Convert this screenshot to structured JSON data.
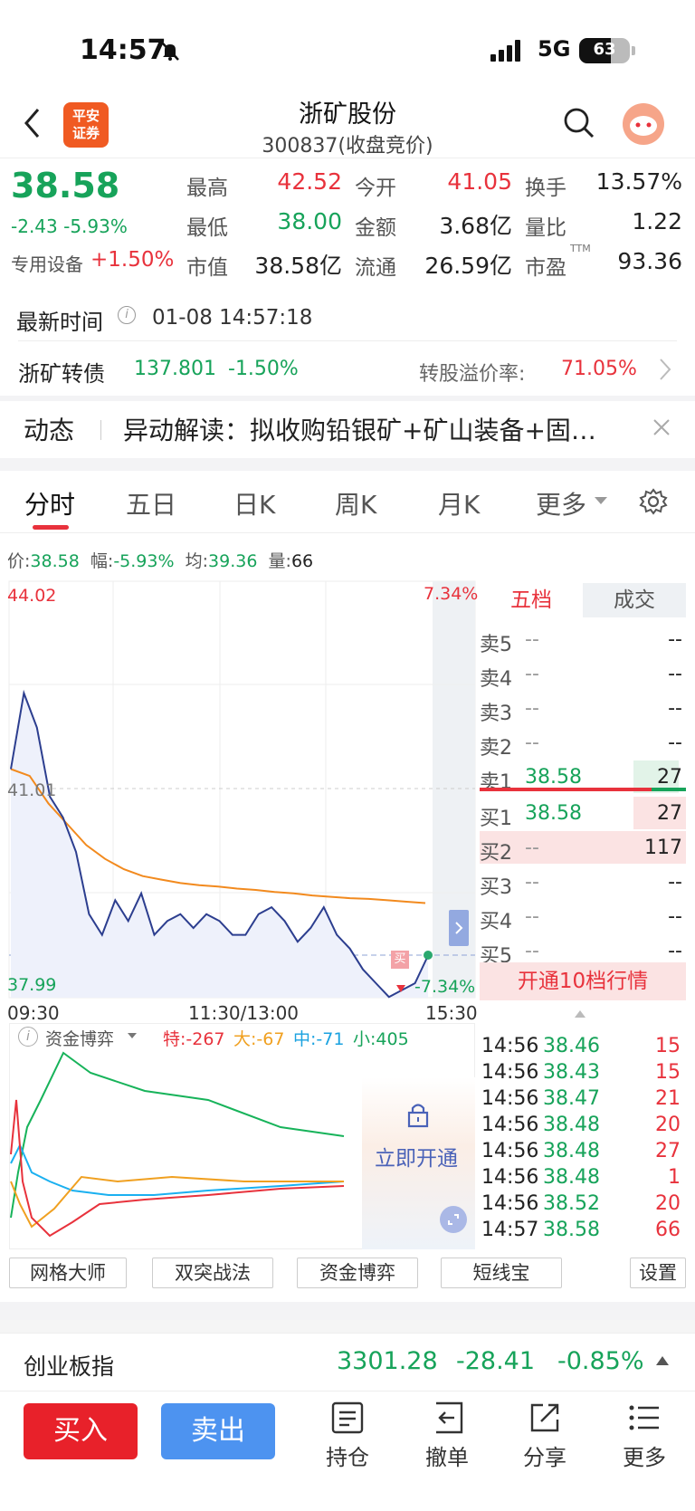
{
  "status_bar": {
    "time": "14:57",
    "network": "5G",
    "battery": "63",
    "battery_level": 0.63
  },
  "header": {
    "logo_line1": "平安",
    "logo_line2": "证券",
    "stock_name": "浙矿股份",
    "stock_code": "300837(收盘竞价)"
  },
  "quote": {
    "price": "38.58",
    "change": "-2.43",
    "change_pct": "-5.93%",
    "sector": "专用设备",
    "sector_change": "+1.50%",
    "high_label": "最高",
    "high": "42.52",
    "open_label": "今开",
    "open": "41.05",
    "turnover_label": "换手",
    "turnover": "13.57%",
    "low_label": "最低",
    "low": "38.00",
    "amount_label": "金额",
    "amount": "3.68亿",
    "vol_ratio_label": "量比",
    "vol_ratio": "1.22",
    "mcap_label": "市值",
    "mcap": "38.58亿",
    "float_label": "流通",
    "float": "26.59亿",
    "pe_label": "市盈",
    "pe_sup": "TTM",
    "pe": "93.36"
  },
  "update": {
    "label": "最新时间",
    "info_icon": "i",
    "time": "01-08 14:57:18"
  },
  "bond": {
    "name": "浙矿转债",
    "price": "137.801",
    "change": "-1.50%",
    "premium_label": "转股溢价率:",
    "premium": "71.05%"
  },
  "news": {
    "tag": "动态",
    "text": "异动解读：拟收购铅银矿+矿山装备+固…"
  },
  "tabs": [
    "分时",
    "五日",
    "日K",
    "周K",
    "月K",
    "更多"
  ],
  "info_line": {
    "p_label": "价:",
    "p": "38.58",
    "f_label": "幅:",
    "f": "-5.93%",
    "a_label": "均:",
    "a": "39.36",
    "v_label": "量:",
    "v": "66"
  },
  "intraday": {
    "y_top": "44.02",
    "y_mid": "41.01",
    "y_bottom": "37.99",
    "pct_top": "7.34%",
    "pct_bottom": "-7.34%",
    "x_start": "09:30",
    "x_mid": "11:30/13:00",
    "x_end": "15:30",
    "buy_marker": "买"
  },
  "chart_data": {
    "type": "line",
    "x": [
      "09:30",
      "11:30/13:00",
      "15:30"
    ],
    "ylim": [
      37.99,
      44.02
    ],
    "yref": 41.01,
    "series": [
      {
        "values": [
          41.3,
          42.4,
          41.9,
          40.9,
          40.6,
          40.1,
          39.2,
          38.9,
          39.4,
          39.1,
          39.5,
          38.9,
          39.1,
          39.2,
          39.0,
          39.2,
          39.1,
          38.9,
          38.9,
          39.2,
          39.3,
          39.1,
          38.8,
          39.0,
          39.3,
          38.9,
          38.7,
          38.4,
          38.2,
          38.0,
          38.1,
          38.2,
          38.6
        ]
      },
      {
        "values": [
          41.3,
          41.2,
          40.8,
          40.5,
          40.2,
          40.0,
          39.85,
          39.75,
          39.7,
          39.65,
          39.62,
          39.6,
          39.57,
          39.55,
          39.52,
          39.5,
          39.47,
          39.45,
          39.43,
          39.42,
          39.4,
          39.38,
          39.36
        ]
      }
    ]
  },
  "depth": {
    "tab_five": "五档",
    "tab_deals": "成交",
    "asks": [
      {
        "label": "卖5",
        "price": "--",
        "vol": "--"
      },
      {
        "label": "卖4",
        "price": "--",
        "vol": "--"
      },
      {
        "label": "卖3",
        "price": "--",
        "vol": "--"
      },
      {
        "label": "卖2",
        "price": "--",
        "vol": "--"
      },
      {
        "label": "卖1",
        "price": "38.58",
        "vol": "27"
      }
    ],
    "bids": [
      {
        "label": "买1",
        "price": "38.58",
        "vol": "27"
      },
      {
        "label": "买2",
        "price": "--",
        "vol": "117"
      },
      {
        "label": "买3",
        "price": "--",
        "vol": "--"
      },
      {
        "label": "买4",
        "price": "--",
        "vol": "--"
      },
      {
        "label": "买5",
        "price": "--",
        "vol": "--"
      }
    ],
    "open_ten": "开通10档行情"
  },
  "ticks": [
    {
      "time": "14:56",
      "price": "38.46",
      "vol": "15"
    },
    {
      "time": "14:56",
      "price": "38.43",
      "vol": "15"
    },
    {
      "time": "14:56",
      "price": "38.47",
      "vol": "21"
    },
    {
      "time": "14:56",
      "price": "38.48",
      "vol": "20"
    },
    {
      "time": "14:56",
      "price": "38.48",
      "vol": "27"
    },
    {
      "time": "14:56",
      "price": "38.48",
      "vol": "1"
    },
    {
      "time": "14:56",
      "price": "38.52",
      "vol": "20"
    },
    {
      "time": "14:57",
      "price": "38.58",
      "vol": "66"
    }
  ],
  "fund_flow": {
    "title": "资金博弈",
    "special": "特:-267",
    "large": "大:-67",
    "medium": "中:-71",
    "small": "小:405",
    "unlock": "立即开通"
  },
  "func_buttons": [
    "网格大师",
    "双突战法",
    "资金博弈",
    "短线宝",
    "设置"
  ],
  "index": {
    "name": "创业板指",
    "value": "3301.28",
    "change": "-28.41",
    "pct": "-0.85%"
  },
  "bottom": {
    "buy": "买入",
    "sell": "卖出",
    "hold": "持仓",
    "cancel": "撤单",
    "share": "分享",
    "more": "更多"
  }
}
